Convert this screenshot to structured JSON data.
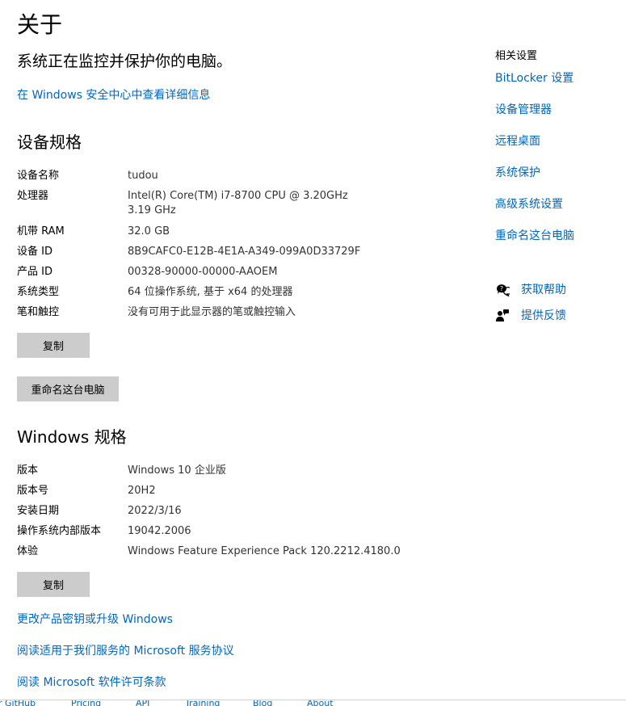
{
  "page": {
    "title": "关于",
    "status": "系统正在监控并保护你的电脑。",
    "security_link": "在 Windows 安全中心中查看详细信息"
  },
  "device_specs": {
    "heading": "设备规格",
    "rows": [
      {
        "label": "设备名称",
        "value": "tudou"
      },
      {
        "label": "处理器",
        "value": "Intel(R) Core(TM) i7-8700 CPU @ 3.20GHz   3.19 GHz"
      },
      {
        "label": "机带 RAM",
        "value": "32.0 GB"
      },
      {
        "label": "设备 ID",
        "value": "8B9CAFC0-E12B-4E1A-A349-099A0D33729F"
      },
      {
        "label": "产品 ID",
        "value": "00328-90000-00000-AAOEM"
      },
      {
        "label": "系统类型",
        "value": "64 位操作系统, 基于 x64 的处理器"
      },
      {
        "label": "笔和触控",
        "value": "没有可用于此显示器的笔或触控输入"
      }
    ],
    "copy_button": "复制",
    "rename_button": "重命名这台电脑"
  },
  "windows_specs": {
    "heading": "Windows 规格",
    "rows": [
      {
        "label": "版本",
        "value": "Windows 10 企业版"
      },
      {
        "label": "版本号",
        "value": "20H2"
      },
      {
        "label": "安装日期",
        "value": "2022/3/16"
      },
      {
        "label": "操作系统内部版本",
        "value": "19042.2006"
      },
      {
        "label": "体验",
        "value": "Windows Feature Experience Pack 120.2212.4180.0"
      }
    ],
    "copy_button": "复制"
  },
  "bottom_links": [
    "更改产品密钥或升级 Windows",
    "阅读适用于我们服务的 Microsoft 服务协议",
    "阅读 Microsoft 软件许可条款"
  ],
  "related": {
    "heading": "相关设置",
    "links": [
      "BitLocker 设置",
      "设备管理器",
      "远程桌面",
      "系统保护",
      "高级系统设置",
      "重命名这台电脑"
    ]
  },
  "help": {
    "get_help": "获取帮助",
    "feedback": "提供反馈",
    "get_help_icon": "chat-help-icon",
    "feedback_icon": "person-feedback-icon"
  },
  "footer_bar": [
    "r GitHub",
    "Pricing",
    "API",
    "Training",
    "Blog",
    "About"
  ],
  "colors": {
    "link": "#0067c0",
    "button": "#cccccc"
  }
}
